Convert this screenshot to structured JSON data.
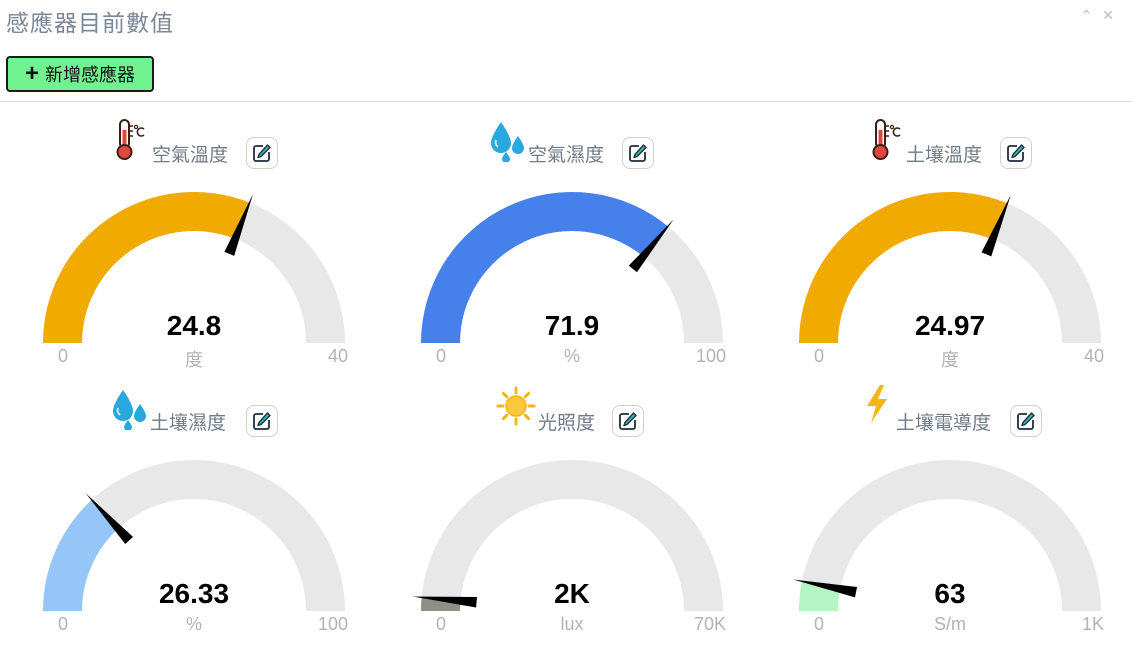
{
  "panel": {
    "title": "感應器目前數值",
    "add_button_label": "新增感應器"
  },
  "colors": {
    "track": "#e9e8e8",
    "needle": "#000000",
    "add_button_bg": "#6ff28f"
  },
  "gauges": [
    {
      "name": "空氣溫度",
      "icon": "thermometer-icon",
      "value_text": "24.8",
      "unit": "度",
      "min_label": "0",
      "max_label": "40",
      "fill_fraction": 0.62,
      "color": "#f0aa00"
    },
    {
      "name": "空氣濕度",
      "icon": "water-drops-icon",
      "value_text": "71.9",
      "unit": "%",
      "min_label": "0",
      "max_label": "100",
      "fill_fraction": 0.719,
      "color": "#4680ea"
    },
    {
      "name": "土壤溫度",
      "icon": "thermometer-icon",
      "value_text": "24.97",
      "unit": "度",
      "min_label": "0",
      "max_label": "40",
      "fill_fraction": 0.624,
      "color": "#f0aa00"
    },
    {
      "name": "土壤濕度",
      "icon": "water-drops-icon",
      "value_text": "26.33",
      "unit": "%",
      "min_label": "0",
      "max_label": "100",
      "fill_fraction": 0.2633,
      "color": "#96c6f7"
    },
    {
      "name": "光照度",
      "icon": "sun-icon",
      "value_text": "2K",
      "unit": "lux",
      "min_label": "0",
      "max_label": "70K",
      "fill_fraction": 0.029,
      "color": "#8f8f86"
    },
    {
      "name": "土壤電導度",
      "icon": "lightning-icon",
      "value_text": "63",
      "unit": "S/m",
      "min_label": "0",
      "max_label": "1K",
      "fill_fraction": 0.063,
      "color": "#b5f5c3"
    }
  ]
}
